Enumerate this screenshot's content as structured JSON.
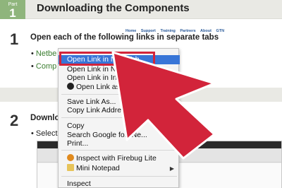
{
  "header": {
    "part_label": "Part",
    "part_number": "1",
    "title": "Downloading the Components"
  },
  "step1": {
    "number": "1",
    "text": "Open each of the following links in separate tabs",
    "bullet1": "Netbe",
    "bullet2": "Comp"
  },
  "step2": {
    "number": "2",
    "text": "Downlo",
    "bullet1": "Select"
  },
  "browser": {
    "nav_links": [
      "Home",
      "Support",
      "Training",
      "Partners",
      "About",
      "GTN"
    ]
  },
  "context_menu": {
    "items": [
      "Open Link in New Tab",
      "Open Link in New Window",
      "Open Link in Incognito Window",
      "Open Link as...",
      "Save Link As...",
      "Copy Link Address",
      "Copy",
      "Search Google for “Ne...",
      "Print...",
      "Inspect with Firebug Lite",
      "Mini Notepad",
      "Inspect"
    ]
  },
  "colors": {
    "highlight": "#3875d7",
    "arrow": "#d2243a",
    "part_badge": "#8fb57c",
    "link_green": "#3a7d2f"
  }
}
